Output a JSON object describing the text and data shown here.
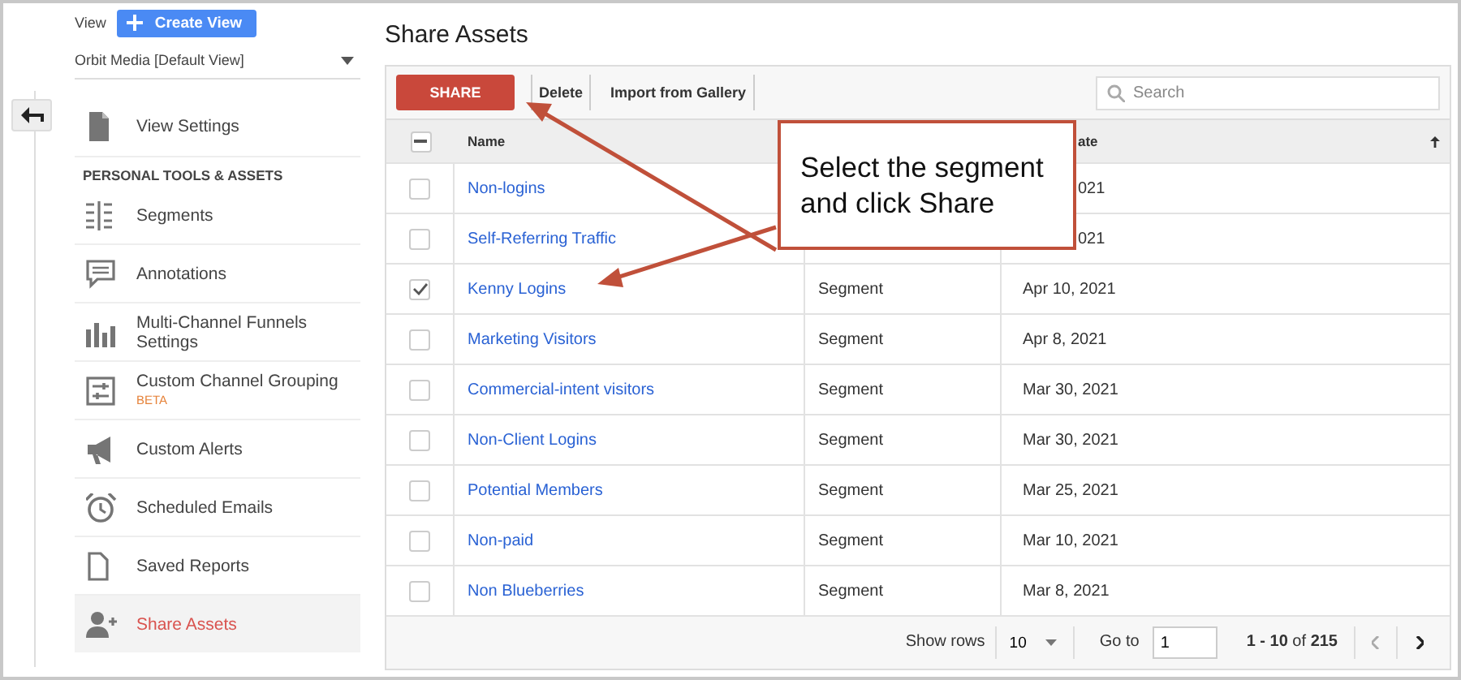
{
  "view": {
    "label": "View",
    "create_button": "Create View",
    "selector": "Orbit Media [Default View]"
  },
  "sidebar": {
    "items": [
      {
        "kind": "item",
        "label": "View Settings",
        "selected": false
      },
      {
        "kind": "section",
        "label": "PERSONAL TOOLS & ASSETS"
      },
      {
        "kind": "item",
        "label": "Segments",
        "selected": false
      },
      {
        "kind": "item",
        "label": "Annotations",
        "selected": false
      },
      {
        "kind": "item",
        "label": "Multi-Channel Funnels Settings",
        "selected": false
      },
      {
        "kind": "item",
        "label": "Custom Channel Grouping",
        "badge": "BETA",
        "selected": false
      },
      {
        "kind": "item",
        "label": "Custom Alerts",
        "selected": false
      },
      {
        "kind": "item",
        "label": "Scheduled Emails",
        "selected": false
      },
      {
        "kind": "item",
        "label": "Saved Reports",
        "selected": false
      },
      {
        "kind": "item",
        "label": "Share Assets",
        "selected": true
      }
    ]
  },
  "page_title": "Share Assets",
  "toolbar": {
    "buttons": [
      {
        "kind": "primary",
        "label": "SHARE"
      },
      {
        "kind": "plain",
        "label": "Delete"
      },
      {
        "kind": "plain",
        "label": "Import from Gallery"
      }
    ],
    "search": {
      "placeholder": "Search"
    }
  },
  "table": {
    "header_checkbox": {
      "indeterminate": true
    },
    "columns": {
      "name": "Name",
      "column_3": "ate"
    },
    "sort_ascending": true,
    "rows": [
      {
        "name": "Non-logins",
        "date": "021",
        "checked": false
      },
      {
        "name": "Self-Referring Traffic",
        "date": "021",
        "checked": false
      },
      {
        "name": "Kenny Logins",
        "type": "Segment",
        "date": "Apr 10, 2021",
        "checked": true
      },
      {
        "name": "Marketing Visitors",
        "type": "Segment",
        "date": "Apr 8, 2021",
        "checked": false
      },
      {
        "name": "Commercial-intent visitors",
        "type": "Segment",
        "date": "Mar 30, 2021",
        "checked": false
      },
      {
        "name": "Non-Client Logins",
        "type": "Segment",
        "date": "Mar 30, 2021",
        "checked": false
      },
      {
        "name": "Potential Members",
        "type": "Segment",
        "date": "Mar 25, 2021",
        "checked": false
      },
      {
        "name": "Non-paid",
        "type": "Segment",
        "date": "Mar 10, 2021",
        "checked": false
      },
      {
        "name": "Non Blueberries",
        "type": "Segment",
        "date": "Mar 8, 2021",
        "checked": false
      }
    ]
  },
  "footer": {
    "show_rows_label": "Show rows",
    "rows_value": "10",
    "goto_label": "Go to",
    "goto_value": "1",
    "range": "**1 - 10** of **215**"
  },
  "callout": {
    "text": "Select the segment and click Share"
  }
}
